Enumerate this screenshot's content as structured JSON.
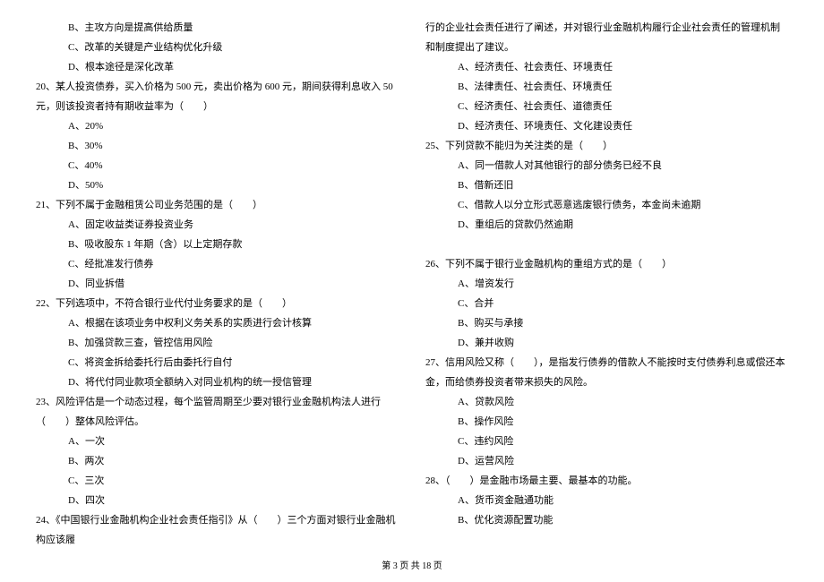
{
  "left": {
    "q19_opt_b": "B、主攻方向是提高供给质量",
    "q19_opt_c": "C、改革的关键是产业结构优化升级",
    "q19_opt_d": "D、根本途径是深化改革",
    "q20_stem": "20、某人投资债券，买入价格为 500 元，卖出价格为 600 元，期间获得利息收入 50 元，则该投资者持有期收益率为（　　）",
    "q20_a": "A、20%",
    "q20_b": "B、30%",
    "q20_c": "C、40%",
    "q20_d": "D、50%",
    "q21_stem": "21、下列不属于金融租赁公司业务范围的是（　　）",
    "q21_a": "A、固定收益类证券投资业务",
    "q21_b": "B、吸收股东 1 年期（含）以上定期存款",
    "q21_c": "C、经批准发行债券",
    "q21_d": "D、同业拆借",
    "q22_stem": "22、下列选项中，不符合银行业代付业务要求的是（　　）",
    "q22_a": "A、根据在该项业务中权利义务关系的实质进行会计核算",
    "q22_b": "B、加强贷款三查，管控信用风险",
    "q22_c": "C、将资金拆给委托行后由委托行自付",
    "q22_d": "D、将代付同业款项全额纳入对同业机构的统一授信管理",
    "q23_stem": "23、风险评估是一个动态过程，每个监管周期至少要对银行业金融机构法人进行（　　）整体风险评估。",
    "q23_a": "A、一次",
    "q23_b": "B、两次",
    "q23_c": "C、三次",
    "q23_d": "D、四次",
    "q24_stem": "24、《中国银行业金融机构企业社会责任指引》从（　　）三个方面对银行业金融机构应该履"
  },
  "right": {
    "q24_cont": "行的企业社会责任进行了阐述，并对银行业金融机构履行企业社会责任的管理机制和制度提出了建议。",
    "q24_a": "A、经济责任、社会责任、环境责任",
    "q24_b": "B、法律责任、社会责任、环境责任",
    "q24_c": "C、经济责任、社会责任、道德责任",
    "q24_d": "D、经济责任、环境责任、文化建设责任",
    "q25_stem": "25、下列贷款不能归为关注类的是（　　）",
    "q25_a": "A、同一借款人对其他银行的部分债务已经不良",
    "q25_b": "B、借新还旧",
    "q25_c": "C、借款人以分立形式恶意逃废银行债务，本金尚未逾期",
    "q25_d": "D、重组后的贷款仍然逾期",
    "q26_stem": "26、下列不属于银行业金融机构的重组方式的是（　　）",
    "q26_a": "A、增资发行",
    "q26_b": "C、合并",
    "q26_c": "B、购买与承接",
    "q26_d": "D、兼并收购",
    "q27_stem": "27、信用风险又称（　　），是指发行债券的借款人不能按时支付债券利息或偿还本金，而给债券投资者带来损失的风险。",
    "q27_a": "A、贷款风险",
    "q27_b": "B、操作风险",
    "q27_c": "C、违约风险",
    "q27_d": "D、运营风险",
    "q28_stem": "28、（　　）是金融市场最主要、最基本的功能。",
    "q28_a": "A、货币资金融通功能",
    "q28_b": "B、优化资源配置功能"
  },
  "footer": "第 3 页 共 18 页"
}
